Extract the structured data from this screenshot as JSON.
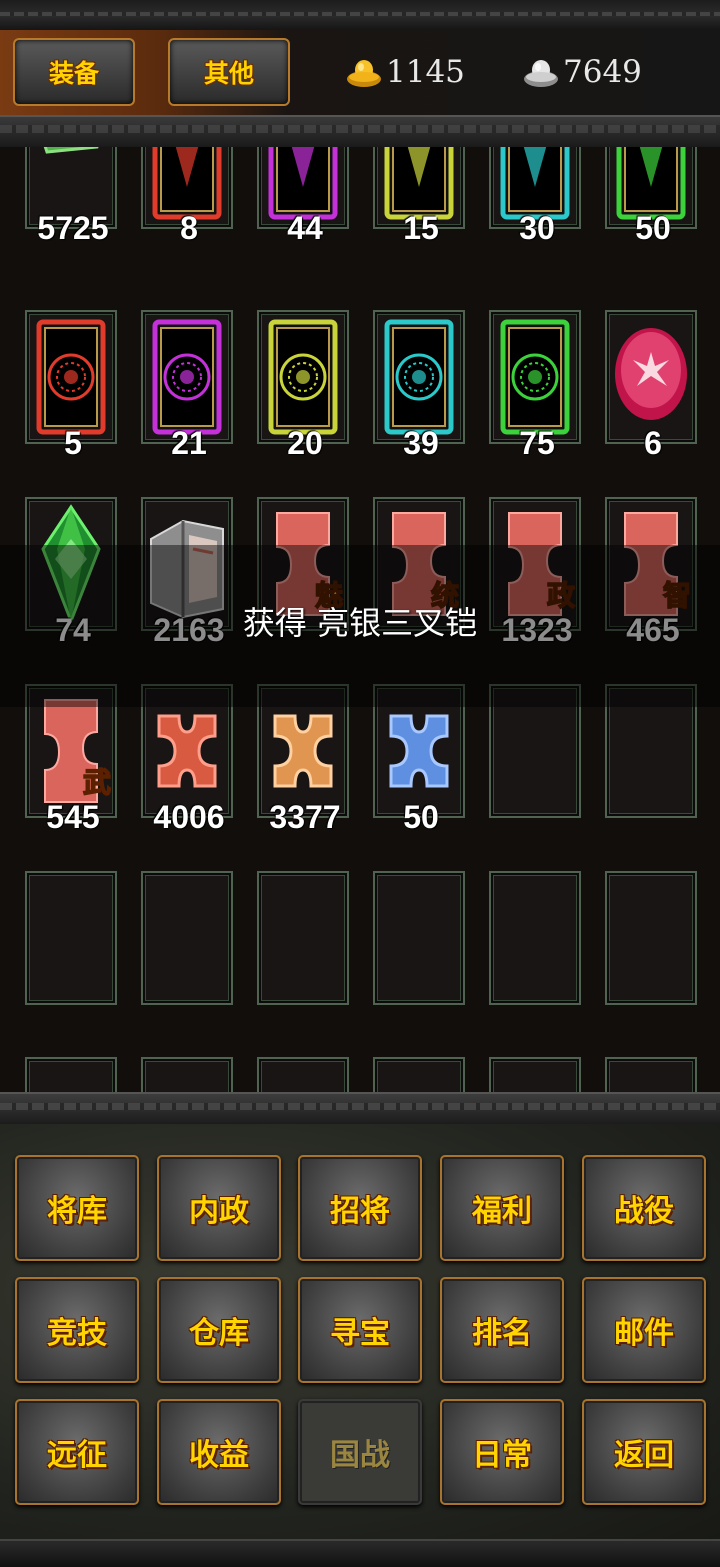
{
  "header": {
    "tabs": [
      {
        "label": "装备",
        "icon": "none"
      },
      {
        "label": "其他",
        "icon": "none"
      }
    ],
    "currencies": [
      {
        "name": "gold-ingot-icon",
        "value": "1145",
        "color": "#f2b21a"
      },
      {
        "name": "silver-ingot-icon",
        "value": "7649",
        "color": "#cfcfcf"
      }
    ]
  },
  "inventory": {
    "rows": [
      [
        {
          "qty": "5725",
          "icon": "jade-item-icon"
        },
        {
          "qty": "8",
          "icon": "red-card-icon"
        },
        {
          "qty": "44",
          "icon": "purple-card-icon"
        },
        {
          "qty": "15",
          "icon": "yellow-card-icon"
        },
        {
          "qty": "30",
          "icon": "cyan-card-icon"
        },
        {
          "qty": "50",
          "icon": "green-card-icon"
        }
      ],
      [
        {
          "qty": "5",
          "icon": "red-seal-card-icon"
        },
        {
          "qty": "21",
          "icon": "purple-seal-card-icon"
        },
        {
          "qty": "20",
          "icon": "yellow-seal-card-icon"
        },
        {
          "qty": "39",
          "icon": "cyan-seal-card-icon"
        },
        {
          "qty": "75",
          "icon": "green-seal-card-icon"
        },
        {
          "qty": "6",
          "icon": "ruby-gem-icon"
        }
      ],
      [
        {
          "qty": "74",
          "icon": "emerald-gem-icon"
        },
        {
          "qty": "2163",
          "icon": "book-icon"
        },
        {
          "qty": "",
          "icon": "puzzle-piece-icon",
          "badge": "魅"
        },
        {
          "qty": "",
          "icon": "puzzle-piece-icon",
          "badge": "统"
        },
        {
          "qty": "1323",
          "icon": "puzzle-piece-icon",
          "badge": "政"
        },
        {
          "qty": "465",
          "icon": "puzzle-piece-icon",
          "badge": "智"
        }
      ],
      [
        {
          "qty": "545",
          "icon": "puzzle-piece-icon",
          "badge": "武"
        },
        {
          "qty": "4006",
          "icon": "red-cross-piece-icon"
        },
        {
          "qty": "3377",
          "icon": "orange-cross-piece-icon"
        },
        {
          "qty": "50",
          "icon": "blue-cross-piece-icon"
        },
        {
          "qty": "",
          "icon": "empty"
        },
        {
          "qty": "",
          "icon": "empty"
        }
      ]
    ]
  },
  "toast": {
    "message": "获得 亮银三叉铠"
  },
  "menu": {
    "rows": [
      [
        "将库",
        "内政",
        "招将",
        "福利",
        "战役"
      ],
      [
        "竞技",
        "仓库",
        "寻宝",
        "排名",
        "邮件"
      ],
      [
        "远征",
        "收益",
        "国战",
        "日常",
        "返回"
      ]
    ],
    "disabled": "国战"
  }
}
